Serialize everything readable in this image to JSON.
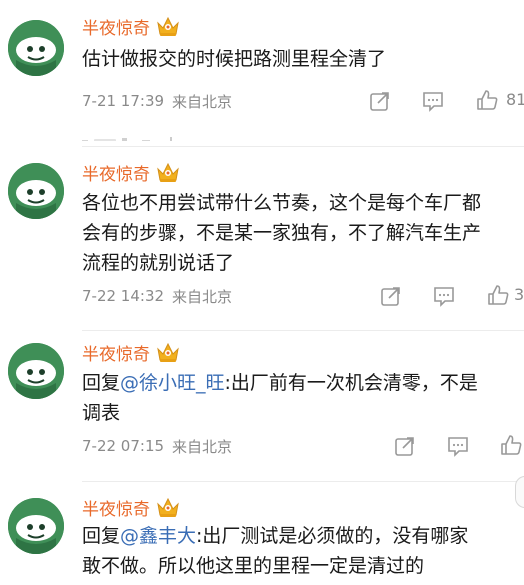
{
  "comments": [
    {
      "username": "半夜惊奇",
      "text_lines": [
        "估计做报交的时候把路测里程全清了"
      ],
      "time": "7-21 17:39",
      "source": "来自北京",
      "likes": "81"
    },
    {
      "username": "半夜惊奇",
      "text_lines": [
        "各位也不用尝试带什么节奏，这个是每个车厂都",
        "会有的步骤，不是某一家独有，不了解汽车生产",
        "流程的就别说话了"
      ],
      "time": "7-22 14:32",
      "source": "来自北京",
      "likes": "3"
    },
    {
      "username": "半夜惊奇",
      "reply_prefix": "回复",
      "mention": "@徐小旺_旺",
      "text_after_mention": ":出厂前有一次机会清零，不是",
      "text_line2": "调表",
      "time": "7-22 07:15",
      "source": "来自北京"
    },
    {
      "username": "半夜惊奇",
      "reply_prefix": "回复",
      "mention": "@鑫丰大",
      "text_after_mention": ":出厂测试是必须做的，没有哪家",
      "text_line2": "敢不做。所以他这里的里程一定是清过的"
    }
  ],
  "icons": {
    "vip": "crown-badge-icon",
    "repost": "repost-icon",
    "comment": "comment-icon",
    "like": "thumbs-up-icon"
  },
  "colors": {
    "username": "#e8692a",
    "mention": "#3a6db5",
    "meta": "#8a8a8a",
    "avatar_bg": "#3f8f57",
    "badge": "#f2b01e"
  }
}
